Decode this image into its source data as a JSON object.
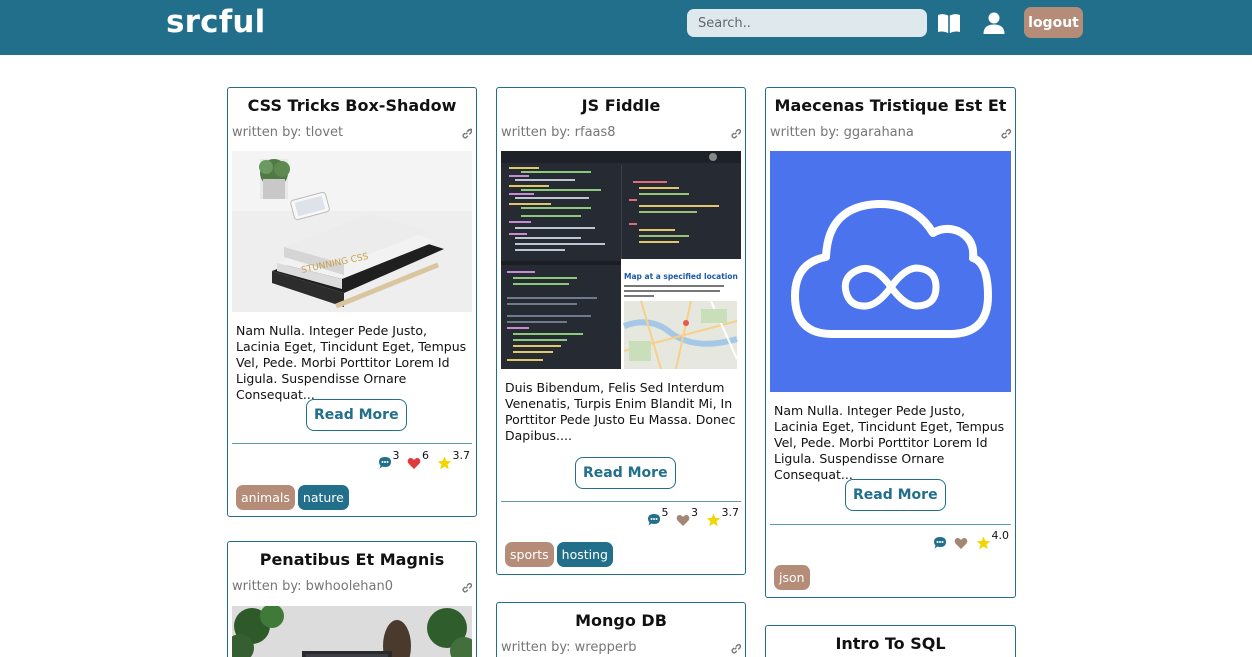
{
  "brand": "srcful",
  "search": {
    "placeholder": "Search.."
  },
  "nav": {
    "logout_label": "logout"
  },
  "colors": {
    "navbar": "#226f8b",
    "tag_brown": "#b48c78",
    "tag_teal": "#226f8b",
    "heart_red": "#e03a3a",
    "star": "#f2d600"
  },
  "cards": [
    {
      "title": "CSS Tricks Box-Shadow",
      "author": "written by: tlovet",
      "excerpt": "Nam Nulla. Integer Pede Justo, Lacinia Eget, Tincidunt Eget, Tempus Vel, Pede. Morbi Porttitor Lorem Id Ligula. Suspendisse Ornare Consequat...",
      "read_more": "Read More",
      "comments": "3",
      "likes": "6",
      "rating": "3.7",
      "tags": [
        "animals",
        "nature"
      ]
    },
    {
      "title": "JS Fiddle",
      "author": "written by: rfaas8",
      "excerpt": "Duis Bibendum, Felis Sed Interdum Venenatis, Turpis Enim Blandit Mi, In Porttitor Pede Justo Eu Massa. Donec Dapibus....",
      "read_more": "Read More",
      "comments": "5",
      "likes": "3",
      "rating": "3.7",
      "tags": [
        "sports",
        "hosting"
      ],
      "screenshot_heading": "Map at a specified location"
    },
    {
      "title": "Maecenas Tristique Est Et",
      "author": "written by: ggarahana",
      "excerpt": "Nam Nulla. Integer Pede Justo, Lacinia Eget, Tincidunt Eget, Tempus Vel, Pede. Morbi Porttitor Lorem Id Ligula. Suspendisse Ornare Consequat...",
      "read_more": "Read More",
      "rating": "4.0",
      "tags": [
        "json"
      ]
    },
    {
      "title": "Penatibus Et Magnis",
      "author": "written by: bwhoolehan0"
    },
    {
      "title": "Mongo DB",
      "author": "written by: wrepperb"
    },
    {
      "title": "Intro To SQL"
    }
  ]
}
